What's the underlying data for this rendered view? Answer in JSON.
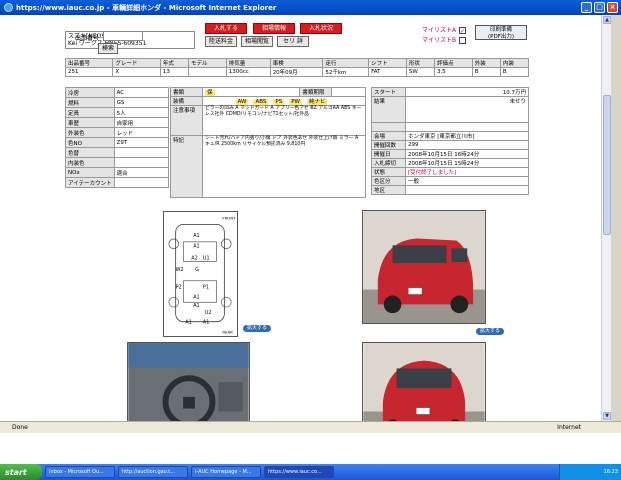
{
  "window": {
    "title": "https://www.iauc.co.jp - 車輌詳細ホンダ - Microsoft Internet Explorer"
  },
  "header": {
    "vehicle_line1": "スズキ[NEOS01][4039]",
    "vehicle_line2": "Kei ワークス HN5S-609351",
    "lot_label": "出品番号",
    "search_btn": "検索",
    "bid_btn": "入札する",
    "related_btn": "相場情報",
    "status_btn": "入札状況",
    "fee_btn": "陸送料金",
    "info_btn": "相場閲覧",
    "set_btn": "セリ 詳",
    "mylist_a": "マイリストA",
    "mylist_b": "マイリストB",
    "pdf_line1": "印刷準備",
    "pdf_line2": "(PDF出力)"
  },
  "summary": {
    "headers": [
      "出品番号",
      "グレード",
      "年式",
      "モデル",
      "排気量",
      "車検",
      "走行",
      "シフト",
      "形状",
      "評価点",
      "外装",
      "内装"
    ],
    "values": [
      "251",
      "X",
      "13",
      "",
      "1300cc",
      "20年09月",
      "52千km",
      "FAT",
      "SW",
      "3.5",
      "B",
      "B"
    ]
  },
  "details_left": [
    {
      "label": "冷房",
      "value": "AC"
    },
    {
      "label": "燃料",
      "value": "GS"
    },
    {
      "label": "定員",
      "value": "5人"
    },
    {
      "label": "車歴",
      "value": "自家用"
    },
    {
      "label": "外装色",
      "value": "レッド"
    },
    {
      "label": "色NO",
      "value": "Z9T"
    },
    {
      "label": "色替",
      "value": ""
    },
    {
      "label": "内装色",
      "value": ""
    },
    {
      "label": "NOx",
      "value": "適合"
    },
    {
      "label": "アイテーカウント",
      "value": ""
    }
  ],
  "details_mid": {
    "doc_label": "書類",
    "doc_value": "保",
    "date_label": "書類期限",
    "equip_label": "装備",
    "equip_items": [
      "AW",
      "ABS",
      "PS",
      "PW",
      "純ナビ"
    ],
    "note_label": "注意事項",
    "note_text": "ビラーの凹み A マッドガード A アプリ一色アセ ⅢZ アルゴAA ABS キーレス社外 CDMD/リモコン/ナビT1セット/社外品",
    "feature_label": "特記",
    "feature_text": "シート汚れ/ハドア内張り/小傷 ドア 外装色あせ 外装仕上げ跡 ミラー A キュ/R 2500km リサイクル預託済み 9,810円"
  },
  "details_right": [
    {
      "label": "スタート",
      "value": "10.7万円"
    },
    {
      "label": "結果",
      "value": "未せり"
    },
    {
      "label": "",
      "value": ""
    },
    {
      "label": "会場",
      "value": "ホンダ東京 [東京都立川市]"
    },
    {
      "label": "開催回数",
      "value": "299"
    },
    {
      "label": "開催日",
      "value": "2008年10月15日 16時24分"
    },
    {
      "label": "入札締切",
      "value": "2008年10月15日 15時24分"
    },
    {
      "label": "状態",
      "value": "[受付終了しました]"
    },
    {
      "label": "色区分",
      "value": "一般"
    },
    {
      "label": "地区",
      "value": ""
    }
  ],
  "photos": {
    "expand_label": "拡大する"
  },
  "diagram": {
    "front": "FRONT",
    "rear": "REAR",
    "marks": [
      "A1",
      "A1",
      "A2",
      "U1",
      "W2",
      "G",
      "P2",
      "P1",
      "A1",
      "A1",
      "U2",
      "A1",
      "A1"
    ]
  },
  "status": {
    "text": "Done",
    "zone": "Internet"
  },
  "taskbar": {
    "start": "start",
    "tasks": [
      "Inbox - Microsoft Ou...",
      "http://auction.gao.t...",
      "i-AUC Homepage - M...",
      "https://www.iauc.co..."
    ],
    "clock": "16:23"
  },
  "colors": {
    "bid_red": "#d41e1e",
    "action_blue": "#1e54b5",
    "car_red": "#c8262e",
    "highlight": "#ffe86a"
  }
}
